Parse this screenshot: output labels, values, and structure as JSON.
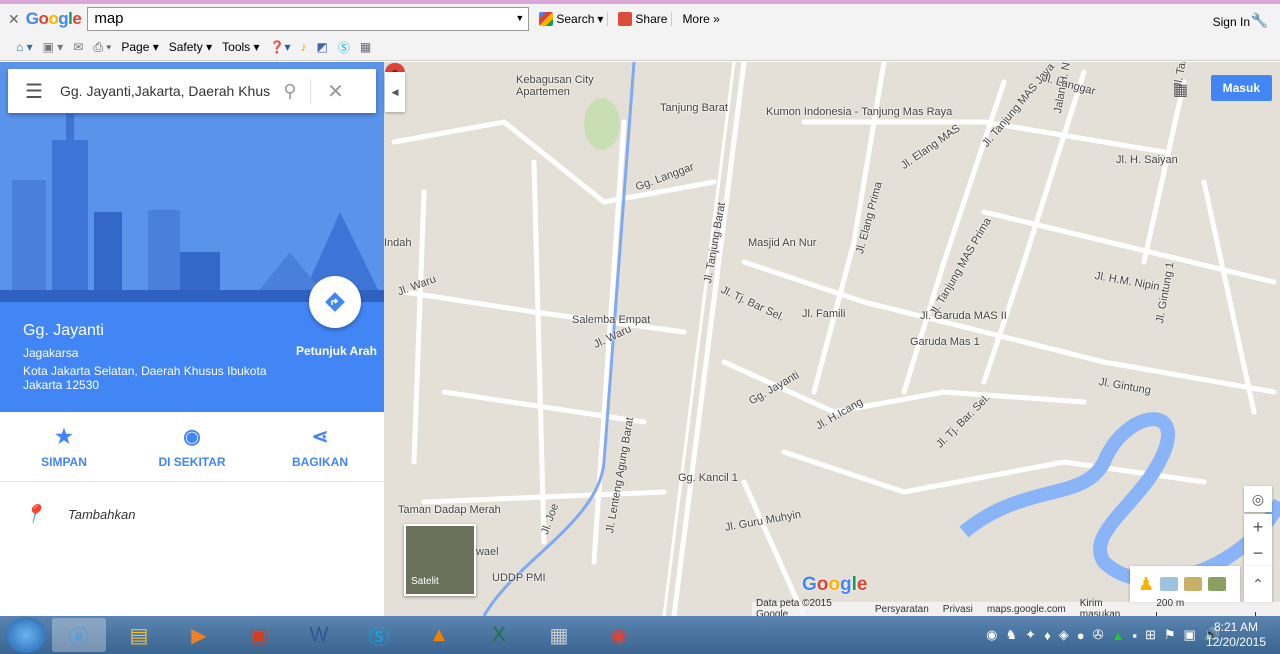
{
  "browser": {
    "search_value": "map",
    "search_label": "Search",
    "share_label": "Share",
    "more_label": "More »",
    "signin_label": "Sign In",
    "toolbar": [
      "Page",
      "Safety",
      "Tools"
    ]
  },
  "sidebar": {
    "search_value": "Gg. Jayanti,Jakarta, Daerah Khusus",
    "place_name": "Gg. Jayanti",
    "place_sub": "Jagakarsa",
    "place_address": "Kota Jakarta Selatan, Daerah Khusus Ibukota Jakarta 12530",
    "directions_label": "Petunjuk Arah",
    "actions": [
      {
        "label": "SIMPAN",
        "icon": "star-icon"
      },
      {
        "label": "DI SEKITAR",
        "icon": "nearby-icon"
      },
      {
        "label": "BAGIKAN",
        "icon": "share-icon"
      }
    ],
    "add_label": "Tambahkan"
  },
  "map": {
    "signin": "Masuk",
    "satellite_label": "Satelit",
    "labels": [
      "Kebagusan City Apartemen",
      "Tanjung Barat",
      "Kumon Indonesia - Tanjung Mas Raya",
      "Gg. Langgar",
      "Jl. Tanjung Barat",
      "Masjid An Nur",
      "Jl. Elang MAS",
      "Jl. Tanjung MAS Jaya",
      "Jalan H. Nawi",
      "Jl. H. Saiyan",
      "Jl. Elang Prima",
      "Jl. Tanjung MAS Prima",
      "Jl. H.M. Nipin",
      "Indah",
      "Jl. Waru",
      "Jl. Tj. Bar Sel.",
      "Jl. Famili",
      "Jl. Garuda MAS II",
      "Garuda Mas 1",
      "Salemba Empat",
      "Jl. Waru",
      "Gg. Jayanti",
      "Jl. Gintung",
      "Jl. Gintung 1",
      "Jl. H.Icang",
      "Jl. Tj. Bar. Sel.",
      "Jl. Lenteng Agung Barat",
      "Gg. Kancil 1",
      "Jl. Guru Muhyin",
      "Jl. Joe",
      "Taman Dadap Merah",
      "Hwael",
      "UDDP PMI",
      "Jl. Langgar",
      "Jl. Tanjung"
    ],
    "footer": [
      "Data peta ©2015 Google",
      "Persyaratan",
      "Privasi",
      "maps.google.com",
      "Kirim masukan",
      "200 m"
    ],
    "accent": "#4285f4",
    "pin_color": "#db4437"
  },
  "taskbar": {
    "time": "8:21 AM",
    "date": "12/20/2015"
  }
}
